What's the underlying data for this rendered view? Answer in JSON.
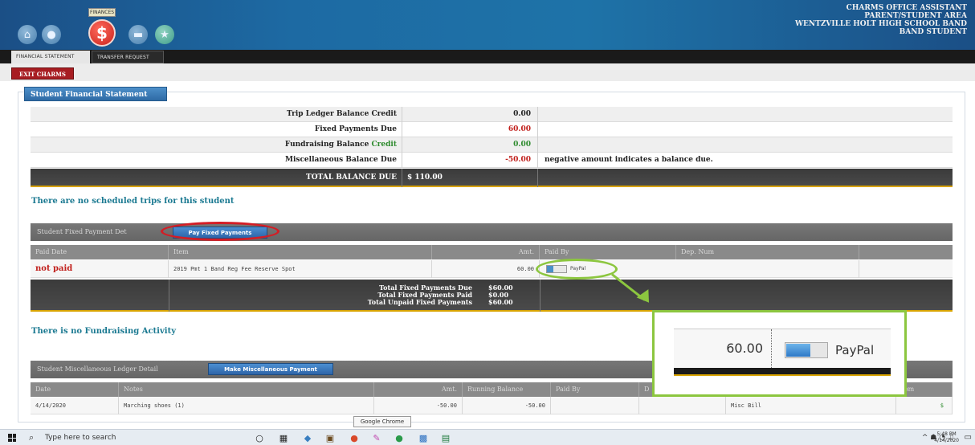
{
  "header": {
    "finances_tag": "FINANCES",
    "app_lines": [
      "CHARMS OFFICE ASSISTANT",
      "PARENT/STUDENT AREA",
      "WENTZVILLE HOLT HIGH SCHOOL BAND",
      "BAND STUDENT"
    ],
    "nav_icons": [
      "home-icon",
      "user-icon",
      "dollar-icon",
      "folder-icon",
      "star-icon"
    ],
    "dollar_glyph": "$"
  },
  "tabs": [
    "FINANCIAL STATEMENT",
    "TRANSFER REQUEST"
  ],
  "exit_label": "EXIT CHARMS",
  "section_title": "Student Financial Statement",
  "summary": [
    {
      "label": "Trip Ledger Balance Credit",
      "value": "0.00",
      "note": ""
    },
    {
      "label": "Fixed Payments Due",
      "value": "60.00",
      "note": ""
    },
    {
      "label_prefix": "Fundraising Balance",
      "label_suffix": "Credit",
      "value": "0.00",
      "note": ""
    },
    {
      "label": "Miscellaneous Balance Due",
      "value": "-50.00",
      "note": "negative amount indicates a balance due."
    }
  ],
  "total": {
    "label": "TOTAL BALANCE DUE",
    "value": "$ 110.00"
  },
  "no_trips": "There are no scheduled trips for this student",
  "fixed": {
    "title": "Student Fixed Payment Det",
    "pay_button": "Pay Fixed Payments",
    "columns": [
      "Paid Date",
      "Item",
      "Amt.",
      "Paid By",
      "Dep. Num"
    ],
    "row": {
      "paid_date": "not paid",
      "item": "2019 Pmt 1 Band Reg Fee Reserve Spot",
      "amt": "60.00",
      "paid_by": "PayPal",
      "dep_num": ""
    },
    "totals": {
      "labels": [
        "Total Fixed Payments Due",
        "Total Fixed Payments Paid",
        "Total Unpaid Fixed Payments"
      ],
      "values": [
        "$60.00",
        "$0.00",
        "$60.00"
      ]
    }
  },
  "no_fundraising": "There is no Fundraising Activity",
  "misc": {
    "title": "Student Miscellaneous Ledger Detail",
    "pay_button": "Make Miscellaneous Payment",
    "columns": [
      "Date",
      "Notes",
      "Amt.",
      "Running Balance",
      "Paid By",
      "D",
      "rom"
    ],
    "row": {
      "date": "4/14/2020",
      "notes": "Marching shoes (1)",
      "amt": "-50.00",
      "running": "-50.00",
      "paid_by": "",
      "misc_bill": "Misc Bill",
      "dollar": "$"
    }
  },
  "callout": {
    "value": "60.00",
    "paid_by": "PayPal"
  },
  "tooltip": "Google Chrome",
  "taskbar": {
    "search_placeholder": "Type here to search",
    "clock_time": "5:48 PM",
    "clock_date": "4/14/2020"
  }
}
